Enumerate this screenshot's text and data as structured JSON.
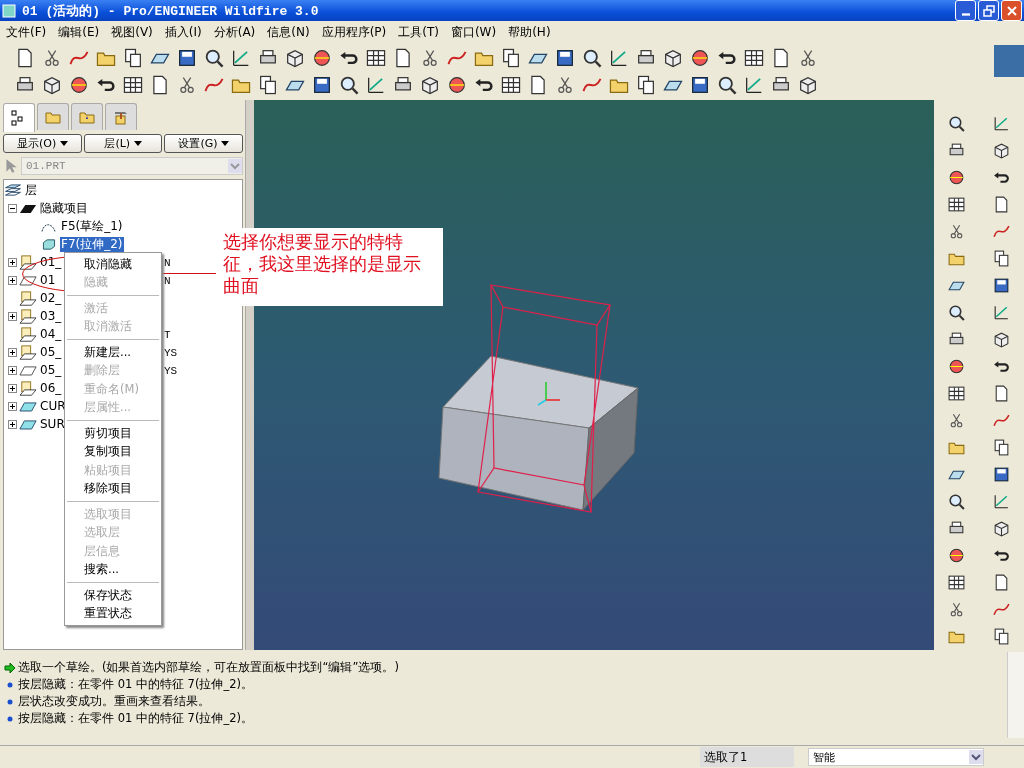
{
  "window": {
    "title": "01 (活动的) - Pro/ENGINEER Wildfire 3.0"
  },
  "menu_bar": [
    "文件(F)",
    "编辑(E)",
    "视图(V)",
    "插入(I)",
    "分析(A)",
    "信息(N)",
    "应用程序(P)",
    "工具(T)",
    "窗口(W)",
    "帮助(H)"
  ],
  "navigator": {
    "tabs": [
      {
        "kind": "tree",
        "selected": true
      },
      {
        "kind": "folders",
        "selected": false
      },
      {
        "kind": "favorites",
        "selected": false
      },
      {
        "kind": "tools",
        "selected": false
      }
    ],
    "buttons": [
      "显示(O)",
      "层(L)",
      "设置(G)"
    ],
    "model_selector": {
      "value": "01.PRT"
    },
    "tree": {
      "label": "层",
      "children": [
        {
          "label": "隐藏项目",
          "kind": "hidden",
          "expanded": true,
          "children": [
            {
              "label": "F5(草绘_1)",
              "kind": "sketch",
              "selected": false
            },
            {
              "label": "F7(拉伸_2)",
              "kind": "extrude",
              "selected": true
            }
          ]
        },
        {
          "label": "01_",
          "suffix": "N",
          "kind": "layer",
          "expanded": false
        },
        {
          "label": "01",
          "suffix": "N",
          "kind": "plane",
          "expanded": false
        },
        {
          "label": "02_",
          "kind": "layer"
        },
        {
          "label": "03_",
          "kind": "layer",
          "expanded": false
        },
        {
          "label": "04_",
          "suffix": "T",
          "kind": "layer"
        },
        {
          "label": "05_",
          "suffix": "YS",
          "kind": "layer",
          "expanded": false
        },
        {
          "label": "05_",
          "suffix": "YS",
          "kind": "plane",
          "expanded": false
        },
        {
          "label": "06_",
          "kind": "layer",
          "expanded": false
        },
        {
          "label": "CUR",
          "kind": "surface",
          "expanded": false
        },
        {
          "label": "SUR",
          "kind": "surface",
          "expanded": false
        }
      ]
    }
  },
  "context_menu": [
    [
      {
        "label": "取消隐藏",
        "disabled": false
      },
      {
        "label": "隐藏",
        "disabled": true
      }
    ],
    [
      {
        "label": "激活",
        "disabled": true
      },
      {
        "label": "取消激活",
        "disabled": true
      }
    ],
    [
      {
        "label": "新建层...",
        "disabled": false
      },
      {
        "label": "删除层",
        "disabled": true
      },
      {
        "label": "重命名(M)",
        "disabled": true
      },
      {
        "label": "层属性...",
        "disabled": true
      }
    ],
    [
      {
        "label": "剪切项目",
        "disabled": false
      },
      {
        "label": "复制项目",
        "disabled": false
      },
      {
        "label": "粘贴项目",
        "disabled": true
      },
      {
        "label": "移除项目",
        "disabled": false
      }
    ],
    [
      {
        "label": "选取项目",
        "disabled": true
      },
      {
        "label": "选取层",
        "disabled": true
      },
      {
        "label": "层信息",
        "disabled": true
      },
      {
        "label": "搜索...",
        "disabled": false
      }
    ],
    [
      {
        "label": "保存状态",
        "disabled": false
      },
      {
        "label": "重置状态",
        "disabled": false
      }
    ]
  ],
  "annotation": {
    "text": "选择你想要显示的特特征，我这里选择的是显示曲面"
  },
  "messages": [
    {
      "kind": "prompt",
      "text": "选取一个草绘。(如果首选内部草绘，可在放置面板中找到“编辑”选项。)"
    },
    {
      "kind": "info",
      "text": "按层隐藏：在零件 01 中的特征 7(拉伸_2)。"
    },
    {
      "kind": "info",
      "text": "层状态改变成功。重画来查看结果。"
    },
    {
      "kind": "info",
      "text": "按层隐藏：在零件 01 中的特征 7(拉伸_2)。"
    }
  ],
  "status_bar": {
    "selection": "选取了1",
    "filter": "智能"
  }
}
